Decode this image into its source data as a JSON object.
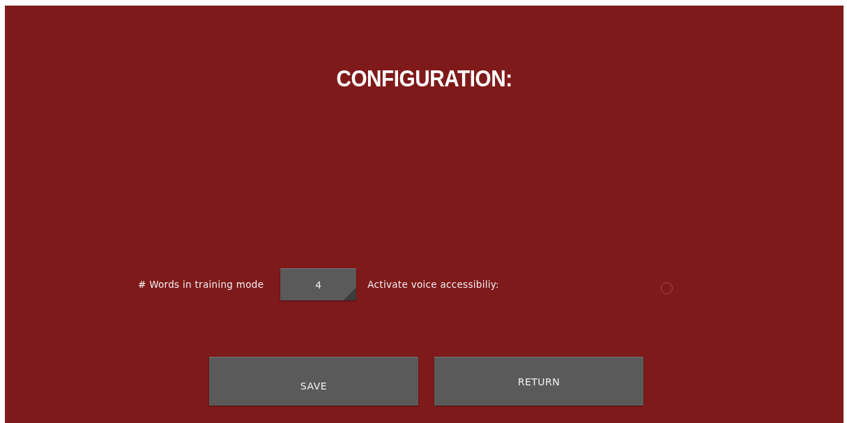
{
  "title": "CONFIGURATION:",
  "words_field": {
    "label": "# Words in training mode",
    "value": "4"
  },
  "voice_option": {
    "label": "Activate voice accessibiliy:",
    "checked": false
  },
  "buttons": [
    {
      "label": "SAVE",
      "kind": "save"
    },
    {
      "label": "RETURN",
      "kind": "return"
    }
  ]
}
